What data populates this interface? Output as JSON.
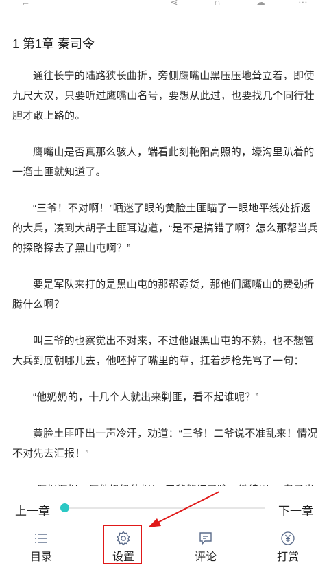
{
  "chapter": {
    "title": "1 第1章 秦司令"
  },
  "paragraphs": [
    "通往长宁的陆路狭长曲折，旁侧鹰嘴山黑压压地耸立着，即使九尺大汉，只要听过鹰嘴山名号，要想从此过，也要找几个同行壮胆才敢上路的。",
    "鹰嘴山是否真那么骇人，端看此刻艳阳高照的，壕沟里趴着的一溜土匪就知道了。",
    "“三爷！不对啊！”晒迷了眼的黄脸土匪瞄了一眼地平线处折返的大兵，凑到大胡子土匪耳边道，“是不是搞错了啊？怎么那帮当兵的探路探去了黑山屯啊？”",
    "要是军队来打的是黑山屯的那帮孬货，那他们鹰嘴山的费劲折腾什么啊？",
    "叫三爷的也察觉出不对来，不过他跟黑山屯的不熟，也不想管大兵到底朝哪儿去，他呸掉了嘴里的草，扛着步枪先骂了一句：",
    "“他奶奶的，十几个人就出来剿匪，看不起谁呢？”",
    "黄脸土匪吓出一声冷汗，劝道：“三爷！二爷说不准乱来！情况不对先去汇报！”",
    "“汇报汇报，汇他奶奶的报！”三爷憋红了脸，继续骂，“老子当土匪"
  ],
  "reader_controls": {
    "prev_label": "上一章",
    "next_label": "下一章",
    "progress": 0.0,
    "accent_color": "#2bc8c4"
  },
  "bottom_nav": {
    "catalog": {
      "label": "目录",
      "icon": "list-icon"
    },
    "settings": {
      "label": "设置",
      "icon": "settings-gear-icon"
    },
    "comment": {
      "label": "评论",
      "icon": "comment-icon"
    },
    "reward": {
      "label": "打赏",
      "icon": "yuan-coin-icon"
    }
  },
  "annotation": {
    "color": "#e01919"
  }
}
